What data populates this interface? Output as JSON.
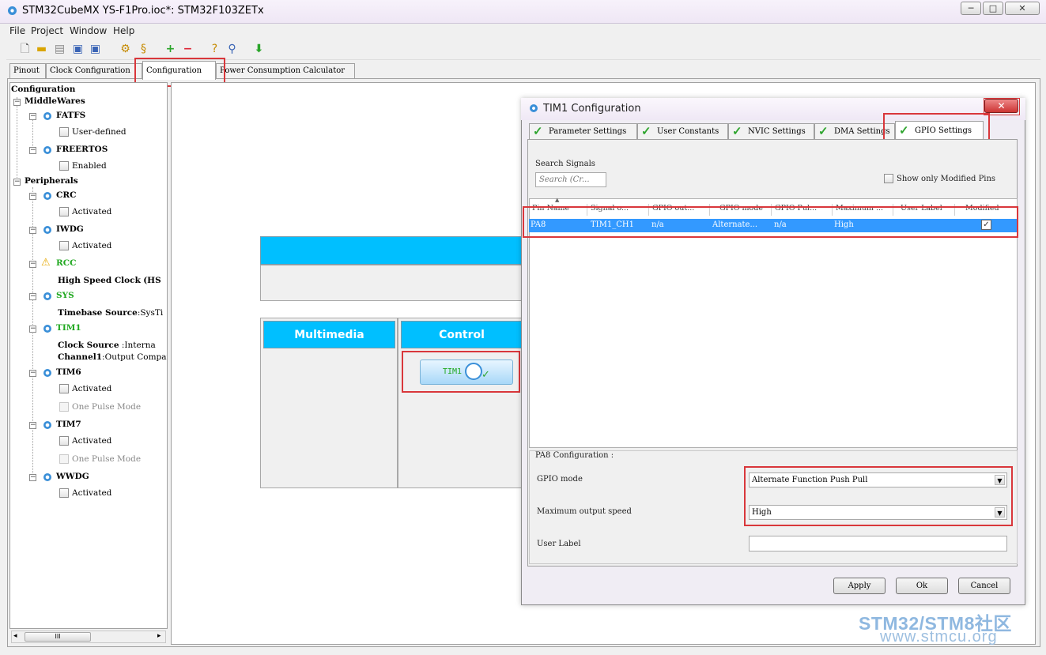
{
  "window": {
    "title": "STM32CubeMX YS-F1Pro.ioc*: STM32F103ZETx",
    "controls": [
      "─",
      "□",
      "✕"
    ]
  },
  "menu": [
    "File",
    "Project",
    "Window",
    "Help"
  ],
  "tabs": [
    "Pinout",
    "Clock Configuration",
    "Configuration",
    "Power Consumption Calculator"
  ],
  "active_tab": "Configuration",
  "tree": {
    "root": "Configuration",
    "middlewares": {
      "label": "MiddleWares",
      "items": [
        {
          "name": "FATFS",
          "option": "User-defined"
        },
        {
          "name": "FREERTOS",
          "option": "Enabled"
        }
      ]
    },
    "peripherals": {
      "label": "Peripherals",
      "crc": {
        "name": "CRC",
        "option": "Activated"
      },
      "iwdg": {
        "name": "IWDG",
        "option": "Activated"
      },
      "rcc": {
        "name": "RCC",
        "detail_label": "High Speed Clock",
        "detail_value": "(HS"
      },
      "sys": {
        "name": "SYS",
        "detail_label": "Timebase Source",
        "detail_value": ":SysTi"
      },
      "tim1": {
        "name": "TIM1",
        "detail1_label": "Clock Source",
        "detail1_value": ":Interna",
        "detail2_label": "Channel1",
        "detail2_value": ":Output Compar"
      },
      "tim6": {
        "name": "TIM6",
        "option1": "Activated",
        "option2": "One Pulse Mode"
      },
      "tim7": {
        "name": "TIM7",
        "option1": "Activated",
        "option2": "One Pulse Mode"
      },
      "wwdg": {
        "name": "WWDG",
        "option": "Activated"
      }
    }
  },
  "scrollbar": {
    "thumb_label": "III"
  },
  "canvas": {
    "multimedia": "Multimedia",
    "control": "Control",
    "tim1_button": "TIM1"
  },
  "dialog": {
    "title": "TIM1 Configuration",
    "close": "✕",
    "tabs": [
      "Parameter Settings",
      "User Constants",
      "NVIC Settings",
      "DMA Settings",
      "GPIO Settings"
    ],
    "active_tab": "GPIO Settings",
    "search_label": "Search Signals",
    "search_placeholder": "Search (Cr...",
    "show_modified_label": "Show only Modified Pins",
    "columns": [
      "Pin Name",
      "Signal o...",
      "GPIO out...",
      "GPIO mode",
      "GPIO Pul...",
      "Maximum ...",
      "User Label",
      "Modified"
    ],
    "rows": [
      {
        "pin": "PA8",
        "signal": "TIM1_CH1",
        "gpio_out": "n/a",
        "gpio_mode": "Alternate...",
        "gpio_pull": "n/a",
        "max_speed": "High",
        "user_label": "",
        "modified": "✓"
      }
    ],
    "config": {
      "title": "PA8 Configuration :",
      "gpio_mode_label": "GPIO mode",
      "gpio_mode_value": "Alternate Function Push Pull",
      "max_speed_label": "Maximum output speed",
      "max_speed_value": "High",
      "user_label_label": "User Label",
      "user_label_value": ""
    },
    "buttons": {
      "apply": "Apply",
      "ok": "Ok",
      "cancel": "Cancel"
    }
  },
  "watermark": {
    "line1": "STM32/STM8社区",
    "line2": "www.stmcu.org"
  },
  "colors": {
    "accent_blue": "#00bfff",
    "selection": "#3399ff",
    "highlight_red": "#d9373b",
    "ok_green": "#1fa81f"
  }
}
